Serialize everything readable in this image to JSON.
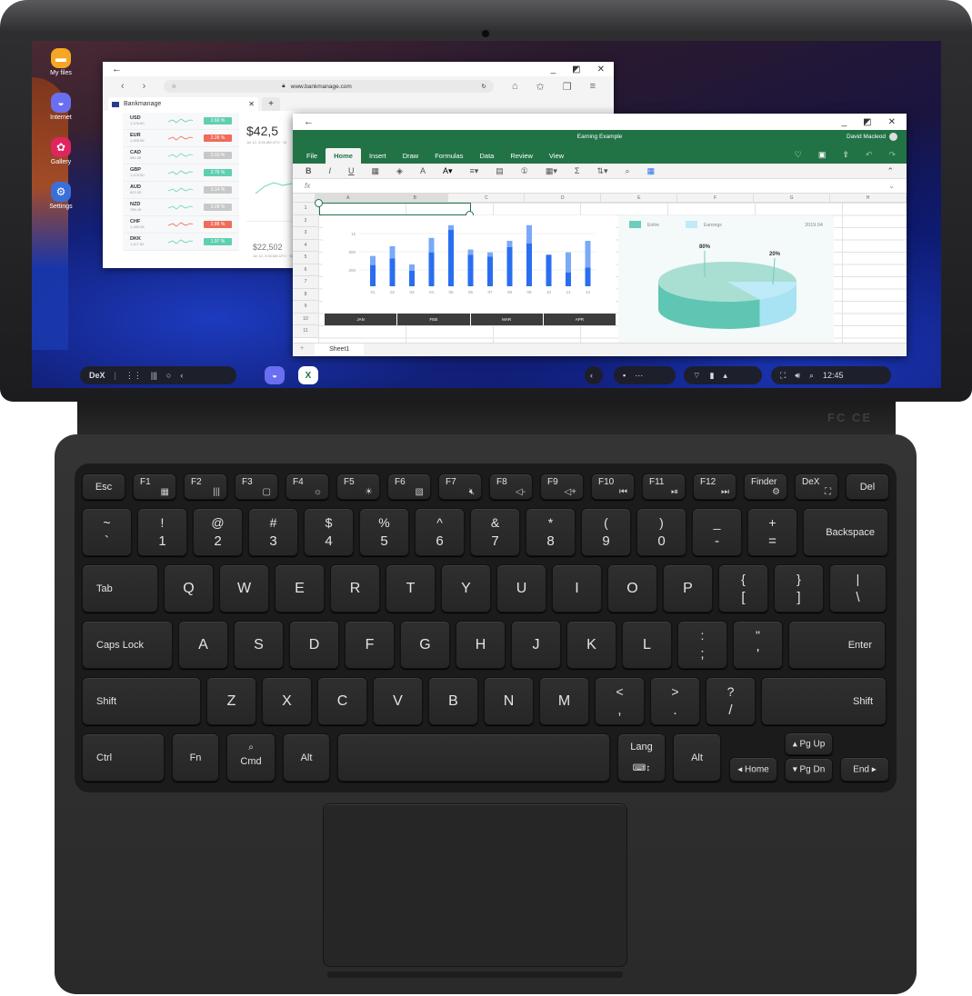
{
  "desktop": {
    "icons": [
      {
        "label": "My files",
        "icon": "folder-icon",
        "color": "#f5a623"
      },
      {
        "label": "Internet",
        "icon": "planet-icon",
        "color": "#6a6ef0"
      },
      {
        "label": "Gallery",
        "icon": "flower-icon",
        "color": "#e0245e"
      },
      {
        "label": "Settings",
        "icon": "gear-icon",
        "color": "#3a6fd8"
      }
    ]
  },
  "browser": {
    "url": "www.bankmanage.com",
    "tab_title": "Bankmanage",
    "currencies": [
      {
        "code": "USD",
        "amount": "1,176.80",
        "change": "2.60 %",
        "status": "up"
      },
      {
        "code": "EUR",
        "amount": "1,325.55",
        "change": "2.28 %",
        "status": "down"
      },
      {
        "code": "CAD",
        "amount": "952.45",
        "change": "2.10 %",
        "status": "flat"
      },
      {
        "code": "GBP",
        "amount": "1,475.50",
        "change": "2.79 %",
        "status": "up"
      },
      {
        "code": "AUD",
        "amount": "822.05",
        "change": "3.14 %",
        "status": "flat"
      },
      {
        "code": "NZD",
        "amount": "785.40",
        "change": "3.28 %",
        "status": "flat"
      },
      {
        "code": "CHF",
        "amount": "1,189.05",
        "change": "2.88 %",
        "status": "down"
      },
      {
        "code": "DKK",
        "amount": "1,117.52",
        "change": "1.97 %",
        "status": "up"
      }
    ],
    "status_colors": {
      "up": "#5fcfb0",
      "down": "#ef6b5b",
      "flat": "#c8c8c8"
    },
    "price_main": "$42,5",
    "price_main_sub": "Jul 12, 3:26 AM UTC · Di",
    "price_second": "$22,502",
    "price_second_sub": "Jul 12, 3:26 AM UTC · Di"
  },
  "excel": {
    "title": "Earning Example",
    "user": "David Macleod",
    "tabs": [
      "File",
      "Home",
      "Insert",
      "Draw",
      "Formulas",
      "Data",
      "Review",
      "View"
    ],
    "active_tab": "Home",
    "fx_label": "fx",
    "columns": [
      "A",
      "B",
      "C",
      "D",
      "E",
      "F",
      "G",
      "H"
    ],
    "rows": [
      "1",
      "2",
      "3",
      "4",
      "5",
      "6",
      "7",
      "8",
      "9",
      "10",
      "11"
    ],
    "month_headers": [
      "JAN",
      "FEB",
      "MAR",
      "APR"
    ],
    "sheet_tab": "Sheet1",
    "add_sheet": "+",
    "accent": "#217346"
  },
  "chart_data": [
    {
      "type": "bar",
      "stacked": true,
      "categories": [
        "01",
        "02",
        "03",
        "04",
        "05",
        "06",
        "07",
        "08",
        "09",
        "10",
        "11",
        "12"
      ],
      "series": [
        {
          "values": [
            280,
            390,
            190,
            490,
            1100,
            450,
            420,
            630,
            730,
            450,
            170,
            240
          ],
          "color": "#2a6ef0"
        },
        {
          "values": [
            150,
            260,
            100,
            390,
            130,
            110,
            70,
            170,
            500,
            0,
            320,
            560
          ],
          "color": "#7aa9f7"
        }
      ],
      "yticks": [
        "200",
        "500",
        "1k"
      ],
      "grid": true
    },
    {
      "type": "pie",
      "legend": [
        "Entire",
        "Earnings"
      ],
      "values": [
        80,
        20
      ],
      "labels": [
        "80%",
        "20%"
      ],
      "colors": [
        "#6fcdbd",
        "#bfeaf7"
      ],
      "date": "2019.04"
    }
  ],
  "taskbar": {
    "dex_label": "DeX",
    "clock": "12:45"
  },
  "keyboard": {
    "function_row": [
      {
        "label": "Esc"
      },
      {
        "label": "F1",
        "icon": "▦"
      },
      {
        "label": "F2",
        "icon": "|||"
      },
      {
        "label": "F3",
        "icon": "▢"
      },
      {
        "label": "F4",
        "icon": "☼"
      },
      {
        "label": "F5",
        "icon": "☀"
      },
      {
        "label": "F6",
        "icon": "▧"
      },
      {
        "label": "F7",
        "icon": "🔇︎"
      },
      {
        "label": "F8",
        "icon": "◁-"
      },
      {
        "label": "F9",
        "icon": "◁+"
      },
      {
        "label": "F10",
        "icon": "⏮"
      },
      {
        "label": "F11",
        "icon": "⏯"
      },
      {
        "label": "F12",
        "icon": "⏭"
      },
      {
        "label": "Finder",
        "icon": "⚙"
      },
      {
        "label": "DeX",
        "icon": "⛶"
      },
      {
        "label": "Del"
      }
    ],
    "number_row": [
      {
        "top": "~",
        "bottom": "`"
      },
      {
        "top": "!",
        "bottom": "1"
      },
      {
        "top": "@",
        "bottom": "2"
      },
      {
        "top": "#",
        "bottom": "3"
      },
      {
        "top": "$",
        "bottom": "4"
      },
      {
        "top": "%",
        "bottom": "5"
      },
      {
        "top": "^",
        "bottom": "6"
      },
      {
        "top": "&",
        "bottom": "7"
      },
      {
        "top": "*",
        "bottom": "8"
      },
      {
        "top": "(",
        "bottom": "9"
      },
      {
        "top": ")",
        "bottom": "0"
      },
      {
        "top": "_",
        "bottom": "-"
      },
      {
        "top": "+",
        "bottom": "="
      },
      {
        "label": "Backspace"
      }
    ],
    "qwerty_row": [
      {
        "label": "Tab"
      },
      {
        "char": "Q"
      },
      {
        "char": "W"
      },
      {
        "char": "E"
      },
      {
        "char": "R"
      },
      {
        "char": "T"
      },
      {
        "char": "Y"
      },
      {
        "char": "U"
      },
      {
        "char": "I"
      },
      {
        "char": "O"
      },
      {
        "char": "P"
      },
      {
        "top": "{",
        "bottom": "["
      },
      {
        "top": "}",
        "bottom": "]"
      },
      {
        "top": "|",
        "bottom": "\\"
      }
    ],
    "home_row": [
      {
        "label": "Caps Lock"
      },
      {
        "char": "A"
      },
      {
        "char": "S"
      },
      {
        "char": "D"
      },
      {
        "char": "F"
      },
      {
        "char": "G"
      },
      {
        "char": "H"
      },
      {
        "char": "J"
      },
      {
        "char": "K"
      },
      {
        "char": "L"
      },
      {
        "top": ":",
        "bottom": ";"
      },
      {
        "top": "\"",
        "bottom": "'"
      },
      {
        "label": "Enter"
      }
    ],
    "shift_row": [
      {
        "label": "Shift"
      },
      {
        "char": "Z"
      },
      {
        "char": "X"
      },
      {
        "char": "C"
      },
      {
        "char": "V"
      },
      {
        "char": "B"
      },
      {
        "char": "N"
      },
      {
        "char": "M"
      },
      {
        "top": "<",
        "bottom": ","
      },
      {
        "top": ">",
        "bottom": "."
      },
      {
        "top": "?",
        "bottom": "/"
      },
      {
        "label": "Shift"
      }
    ],
    "bottom_row": [
      {
        "label": "Ctrl"
      },
      {
        "label": "Fn"
      },
      {
        "label": "Cmd",
        "icon": "⌕"
      },
      {
        "label": "Alt"
      },
      {
        "label": ""
      },
      {
        "label": "Lang",
        "icon": "⌨↕"
      },
      {
        "label": "Alt"
      },
      {
        "label": "◂ Home"
      },
      {
        "label": "▴ Pg Up"
      },
      {
        "label": "▾ Pg Dn"
      },
      {
        "label": "End ▸"
      }
    ]
  }
}
